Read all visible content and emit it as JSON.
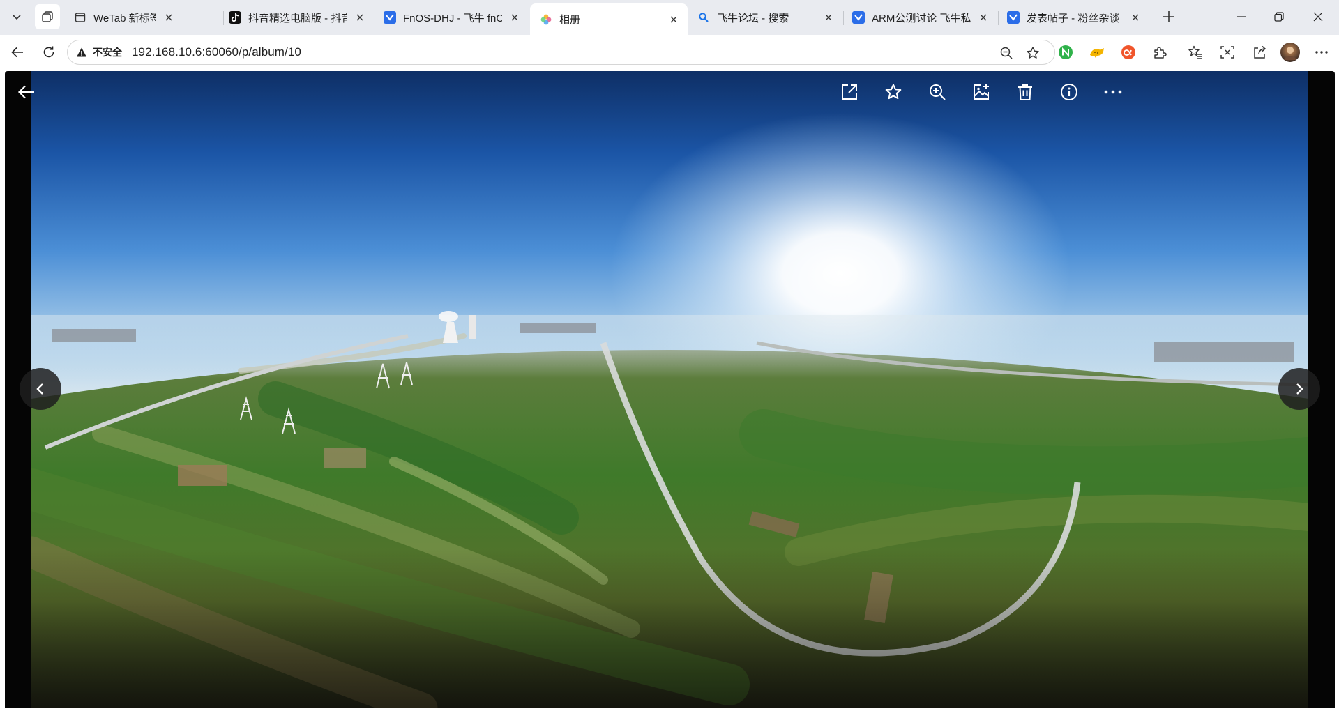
{
  "browser": {
    "tabs": [
      {
        "title": "WeTab 新标签页",
        "favicon": "wetab-icon",
        "active": false
      },
      {
        "title": "抖音精选电脑版 - 抖音",
        "favicon": "douyin-icon",
        "active": false
      },
      {
        "title": "FnOS-DHJ - 飞牛 fnOS",
        "favicon": "fnos-icon",
        "active": false
      },
      {
        "title": "相册",
        "favicon": "photos-icon",
        "active": true
      },
      {
        "title": "飞牛论坛 - 搜索",
        "favicon": "search-icon",
        "active": false
      },
      {
        "title": "ARM公测讨论 飞牛私有",
        "favicon": "fnos-icon",
        "active": false
      },
      {
        "title": "发表帖子 - 粉丝杂谈 飞",
        "favicon": "fnos-icon",
        "active": false
      }
    ],
    "address_bar": {
      "security_label": "不安全",
      "url": "192.168.10.6:60060/p/album/10"
    },
    "colors": {
      "tabstrip": "#e9ebf0",
      "accent": "#1a73e8"
    }
  },
  "viewer": {
    "toolbar_icons": [
      "open-external-icon",
      "favorite-star-icon",
      "zoom-in-icon",
      "add-to-album-icon",
      "delete-trash-icon",
      "info-icon",
      "more-icon"
    ],
    "photo_description_icon": "panorama-photo"
  }
}
